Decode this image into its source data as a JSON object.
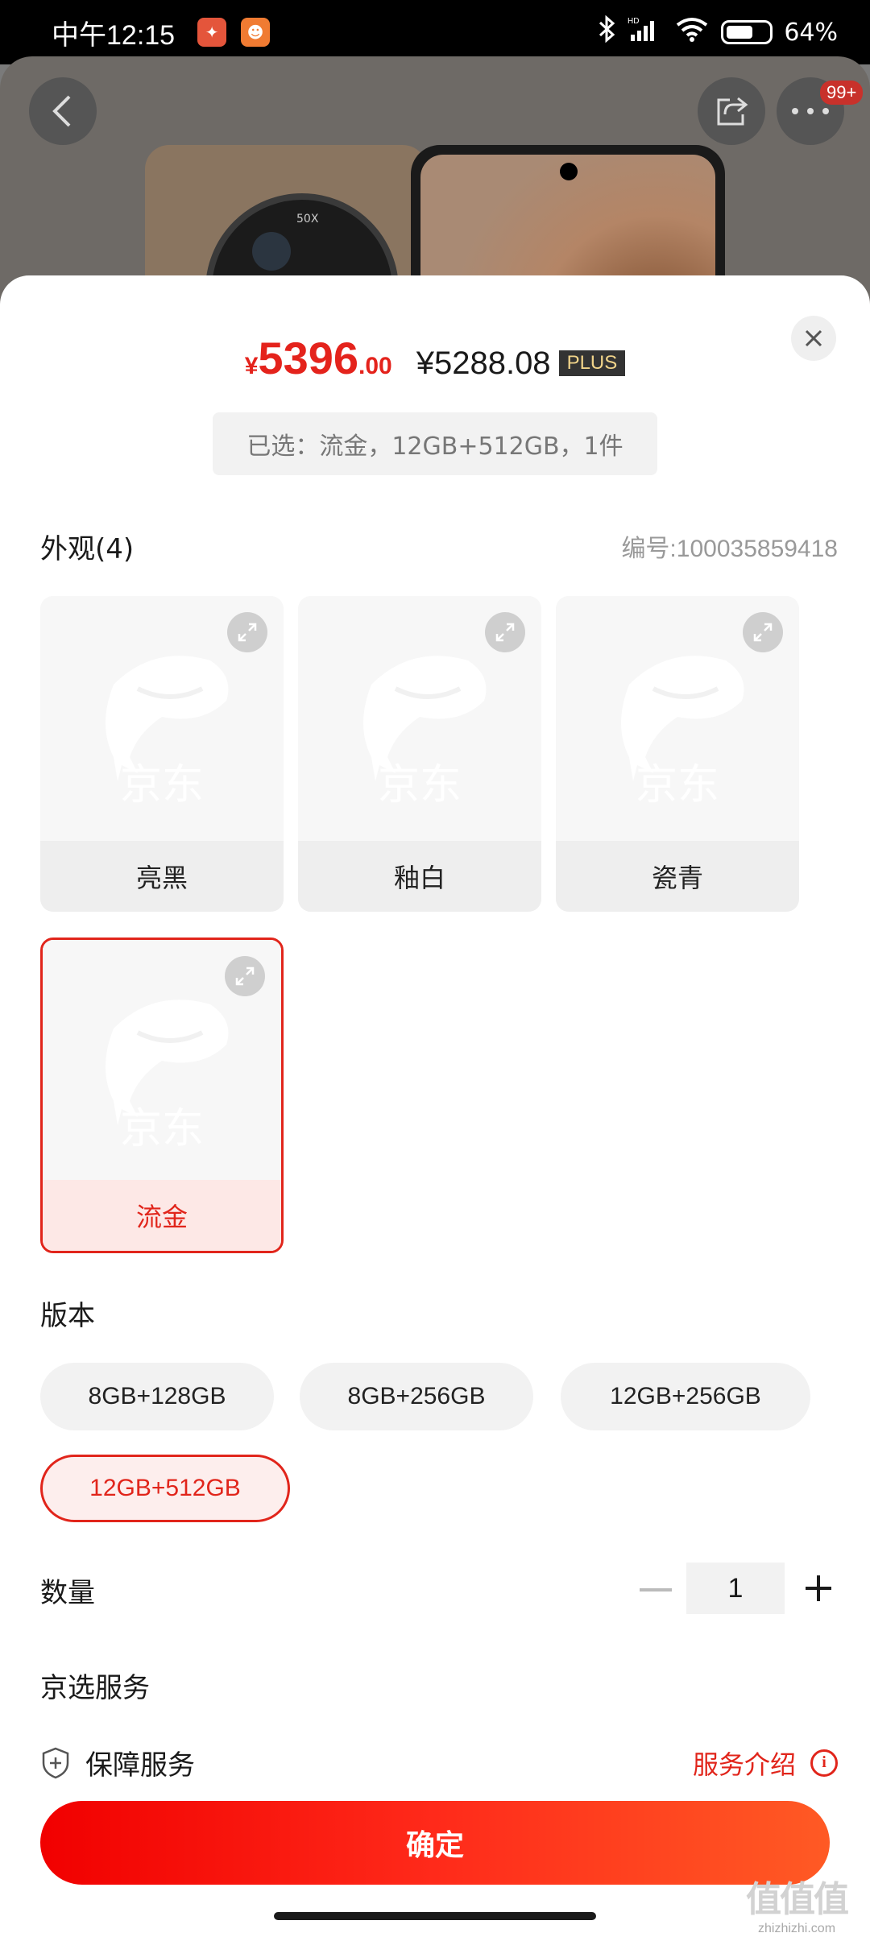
{
  "status_bar": {
    "time": "中午12:15",
    "battery": "64%",
    "battery_level": 0.64
  },
  "header": {
    "badge": "99+"
  },
  "product_image": {
    "camera_label": "50X"
  },
  "price": {
    "symbol": "¥",
    "integer": "5396",
    "decimal": ".00",
    "plus_price": "¥5288.08",
    "plus_tag": "PLUS"
  },
  "selected_summary": "已选：流金，12GB+512GB，1件",
  "appearance": {
    "title": "外观(4)",
    "sku": "编号:100035859418",
    "options": [
      {
        "label": "亮黑",
        "watermark": "京东"
      },
      {
        "label": "釉白",
        "watermark": "京东"
      },
      {
        "label": "瓷青",
        "watermark": "京东"
      },
      {
        "label": "流金",
        "watermark": "京东"
      }
    ],
    "selected": "流金"
  },
  "version": {
    "title": "版本",
    "options": [
      "8GB+128GB",
      "8GB+256GB",
      "12GB+256GB",
      "12GB+512GB"
    ],
    "selected": "12GB+512GB"
  },
  "quantity": {
    "title": "数量",
    "value": "1"
  },
  "services": {
    "title": "京选服务",
    "item": "保障服务",
    "intro_link": "服务介绍"
  },
  "confirm_label": "确定",
  "site_watermark": {
    "logo": "值值值",
    "url": "zhizhizhi.com"
  },
  "colors": {
    "accent": "#e1251b",
    "price_red": "#e4231c",
    "plus_gold": "#f1d48a"
  }
}
